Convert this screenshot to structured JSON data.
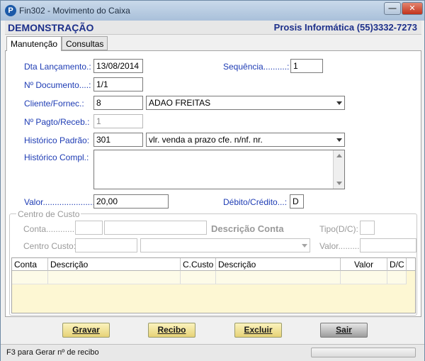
{
  "window": {
    "title": "Fin302 - Movimento do Caixa",
    "min_symbol": "—",
    "close_symbol": "✕",
    "app_icon_letter": "P"
  },
  "brand": {
    "left": "DEMONSTRAÇÃO",
    "right": "Prosis Informática (55)3332-7273"
  },
  "tabs": [
    "Manutenção",
    "Consultas"
  ],
  "form": {
    "dt_label": "Dta Lançamento.:",
    "dt_value": "13/08/2014",
    "seq_label": "Sequência..........:",
    "seq_value": "1",
    "doc_label": "Nº Documento....:",
    "doc_value": "1/1",
    "cliente_label": "Cliente/Fornec.:",
    "cliente_code": "8",
    "cliente_name": "ADAO FREITAS",
    "pagto_label": "Nº Pagto/Receb.:",
    "pagto_value": "1",
    "hist_label": "Histórico Padrão:",
    "hist_code": "301",
    "hist_text": "vlr. venda a prazo cfe. n/nf. nr.",
    "compl_label": "Histórico Compl.:",
    "compl_value": "",
    "valor_label": "Valor.......................:",
    "valor_value": "20,00",
    "dc_label": "Débito/Crédito...:",
    "dc_value": "D"
  },
  "centro_custo": {
    "title": "Centro de Custo",
    "conta_label": "Conta..............:",
    "descricao_label": "Descrição Conta",
    "tipo_label": "Tipo(D/C):",
    "cc_label": "Centro Custo:",
    "valor_label": "Valor.........:"
  },
  "grid": {
    "headers": [
      "Conta",
      "Descrição",
      "C.Custo",
      "Descrição",
      "Valor",
      "D/C"
    ]
  },
  "buttons": {
    "gravar": "Gravar",
    "recibo": "Recibo",
    "excluir": "Excluir",
    "sair": "Sair"
  },
  "status": {
    "text": "F3 para Gerar nº de recibo"
  }
}
